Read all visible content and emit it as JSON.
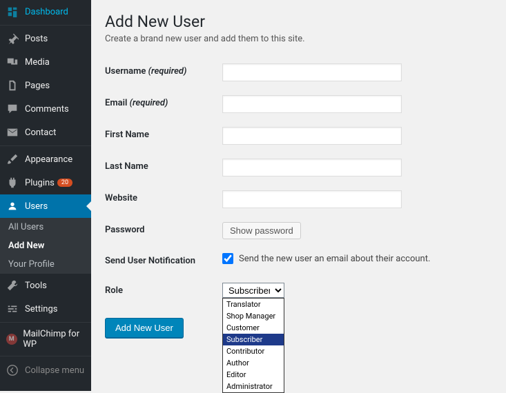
{
  "sidebar": {
    "items": [
      {
        "label": "Dashboard"
      },
      {
        "label": "Posts"
      },
      {
        "label": "Media"
      },
      {
        "label": "Pages"
      },
      {
        "label": "Comments"
      },
      {
        "label": "Contact"
      },
      {
        "label": "Appearance"
      },
      {
        "label": "Plugins",
        "badge": "20"
      },
      {
        "label": "Users"
      },
      {
        "label": "Tools"
      },
      {
        "label": "Settings"
      },
      {
        "label": "MailChimp for WP"
      }
    ],
    "submenu": [
      {
        "label": "All Users"
      },
      {
        "label": "Add New"
      },
      {
        "label": "Your Profile"
      }
    ],
    "collapse": "Collapse menu"
  },
  "page": {
    "title": "Add New User",
    "subtitle": "Create a brand new user and add them to this site."
  },
  "form": {
    "username_label": "Username",
    "required_text": "(required)",
    "email_label": "Email",
    "firstname_label": "First Name",
    "lastname_label": "Last Name",
    "website_label": "Website",
    "password_label": "Password",
    "show_password_btn": "Show password",
    "notification_label": "Send User Notification",
    "notification_text": "Send the new user an email about their account.",
    "role_label": "Role",
    "role_selected": "Subscriber",
    "role_options": [
      "Translator",
      "Shop Manager",
      "Customer",
      "Subscriber",
      "Contributor",
      "Author",
      "Editor",
      "Administrator"
    ],
    "submit_btn": "Add New User"
  }
}
